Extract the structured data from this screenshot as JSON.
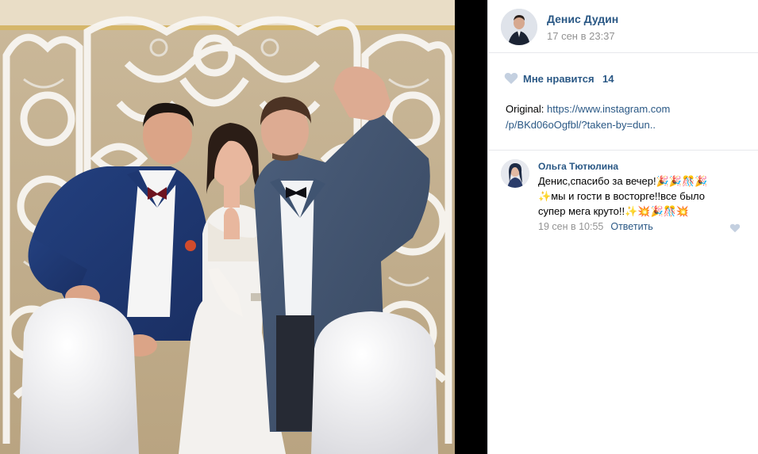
{
  "post": {
    "author_name": "Денис Дудин",
    "date": "17 сен в 23:37",
    "likes_label": "Мне нравится",
    "likes_count": "14",
    "caption_prefix": "Original: ",
    "caption_link_line1": "https://www.instagram.com",
    "caption_link_line2": "/p/BKd06oOgfbl/?taken-by=dun.."
  },
  "comment": {
    "author": "Ольга Тютюлина",
    "text_line1": "Денис,спасибо за вечер!",
    "text_line2": "мы и гости в восторге!!все было",
    "text_line3": "супер мега круто!!",
    "date": "19 сен в 10:55",
    "reply_label": "Ответить"
  },
  "colors": {
    "link": "#2a5885",
    "muted": "#939393",
    "like_heart": "#c4d0e0"
  },
  "icons": {
    "like": "heart-icon",
    "comment_like": "heart-icon"
  }
}
